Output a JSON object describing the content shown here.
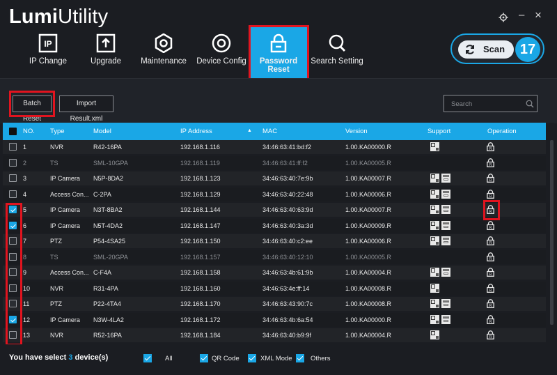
{
  "app": {
    "title_bold": "Lumi",
    "title_rest": "Utility"
  },
  "window": {
    "settings_icon": "gear-icon",
    "minimize": "–",
    "close": "×"
  },
  "nav": [
    {
      "label": "IP Change",
      "icon": "ip-icon"
    },
    {
      "label": "Upgrade",
      "icon": "upload-icon"
    },
    {
      "label": "Maintenance",
      "icon": "hexagon-gear-icon"
    },
    {
      "label": "Device Config",
      "icon": "circle-config-icon"
    },
    {
      "label": "Password Reset",
      "icon": "lock-icon",
      "active": true
    },
    {
      "label": "Search Setting",
      "icon": "magnifier-icon"
    }
  ],
  "scan": {
    "label": "Scan",
    "count": "17"
  },
  "toolbar": {
    "batch_reset": "Batch Reset",
    "import_result": "Import Result.xml",
    "search_placeholder": "Search"
  },
  "table": {
    "headers": {
      "no": "NO.",
      "type": "Type",
      "model": "Model",
      "ip": "IP Address",
      "ip_sort": "▲",
      "mac": "MAC",
      "version": "Version",
      "support": "Support",
      "operation": "Operation"
    },
    "rows": [
      {
        "no": "1",
        "type": "NVR",
        "model": "R42-16PA",
        "ip": "192.168.1.116",
        "mac": "34:46:63:41:bd:f2",
        "version": "1.00.KA00000.R",
        "support": [
          "qr"
        ],
        "checked": false,
        "dim": false
      },
      {
        "no": "2",
        "type": "TS",
        "model": "SML-10GPA",
        "ip": "192.168.1.119",
        "mac": "34:46:63:41:ff:f2",
        "version": "1.00.KA00005.R",
        "support": [],
        "checked": false,
        "dim": true
      },
      {
        "no": "3",
        "type": "IP Camera",
        "model": "N5P-8DA2",
        "ip": "192.168.1.123",
        "mac": "34:46:63:40:7e:9b",
        "version": "1.00.KA00007.R",
        "support": [
          "qr",
          "xml"
        ],
        "checked": false,
        "dim": false
      },
      {
        "no": "4",
        "type": "Access Con...",
        "model": "C-2PA",
        "ip": "192.168.1.129",
        "mac": "34:46:63:40:22:48",
        "version": "1.00.KA00006.R",
        "support": [
          "qr",
          "xml"
        ],
        "checked": false,
        "dim": false
      },
      {
        "no": "5",
        "type": "IP Camera",
        "model": "N3T-8BA2",
        "ip": "192.168.1.144",
        "mac": "34:46:63:40:63:9d",
        "version": "1.00.KA00007.R",
        "support": [
          "qr",
          "xml"
        ],
        "checked": true,
        "dim": false
      },
      {
        "no": "6",
        "type": "IP Camera",
        "model": "N5T-4DA2",
        "ip": "192.168.1.147",
        "mac": "34:46:63:40:3a:3d",
        "version": "1.00.KA00009.R",
        "support": [
          "qr",
          "xml"
        ],
        "checked": true,
        "dim": false
      },
      {
        "no": "7",
        "type": "PTZ",
        "model": "P54-4SA25",
        "ip": "192.168.1.150",
        "mac": "34:46:63:40:c2:ee",
        "version": "1.00.KA00006.R",
        "support": [
          "qr",
          "xml"
        ],
        "checked": false,
        "dim": false
      },
      {
        "no": "8",
        "type": "TS",
        "model": "SML-20GPA",
        "ip": "192.168.1.157",
        "mac": "34:46:63:40:12:10",
        "version": "1.00.KA00005.R",
        "support": [],
        "checked": false,
        "dim": true
      },
      {
        "no": "9",
        "type": "Access Con...",
        "model": "C-F4A",
        "ip": "192.168.1.158",
        "mac": "34:46:63:4b:61:9b",
        "version": "1.00.KA00004.R",
        "support": [
          "qr",
          "xml"
        ],
        "checked": false,
        "dim": false
      },
      {
        "no": "10",
        "type": "NVR",
        "model": "R31-4PA",
        "ip": "192.168.1.160",
        "mac": "34:46:63:4e:ff:14",
        "version": "1.00.KA00008.R",
        "support": [
          "qr"
        ],
        "checked": false,
        "dim": false
      },
      {
        "no": "11",
        "type": "PTZ",
        "model": "P22-4TA4",
        "ip": "192.168.1.170",
        "mac": "34:46:63:43:90:7c",
        "version": "1.00.KA00008.R",
        "support": [
          "qr",
          "xml"
        ],
        "checked": false,
        "dim": false
      },
      {
        "no": "12",
        "type": "IP Camera",
        "model": "N3W-4LA2",
        "ip": "192.168.1.172",
        "mac": "34:46:63:4b:6a:54",
        "version": "1.00.KA00000.R",
        "support": [
          "qr",
          "xml"
        ],
        "checked": true,
        "dim": false
      },
      {
        "no": "13",
        "type": "NVR",
        "model": "R52-16PA",
        "ip": "192.168.1.184",
        "mac": "34:46:63:40:b9:9f",
        "version": "1.00.KA00004.R",
        "support": [
          "qr"
        ],
        "checked": false,
        "dim": false
      }
    ]
  },
  "footer": {
    "prefix": "You have select",
    "count": "3",
    "suffix": "device(s)",
    "filters": [
      "All",
      "QR Code",
      "XML Mode",
      "Others"
    ]
  },
  "colors": {
    "accent": "#1aa7e6",
    "highlight": "#e1141f",
    "background": "#1b1d22"
  }
}
